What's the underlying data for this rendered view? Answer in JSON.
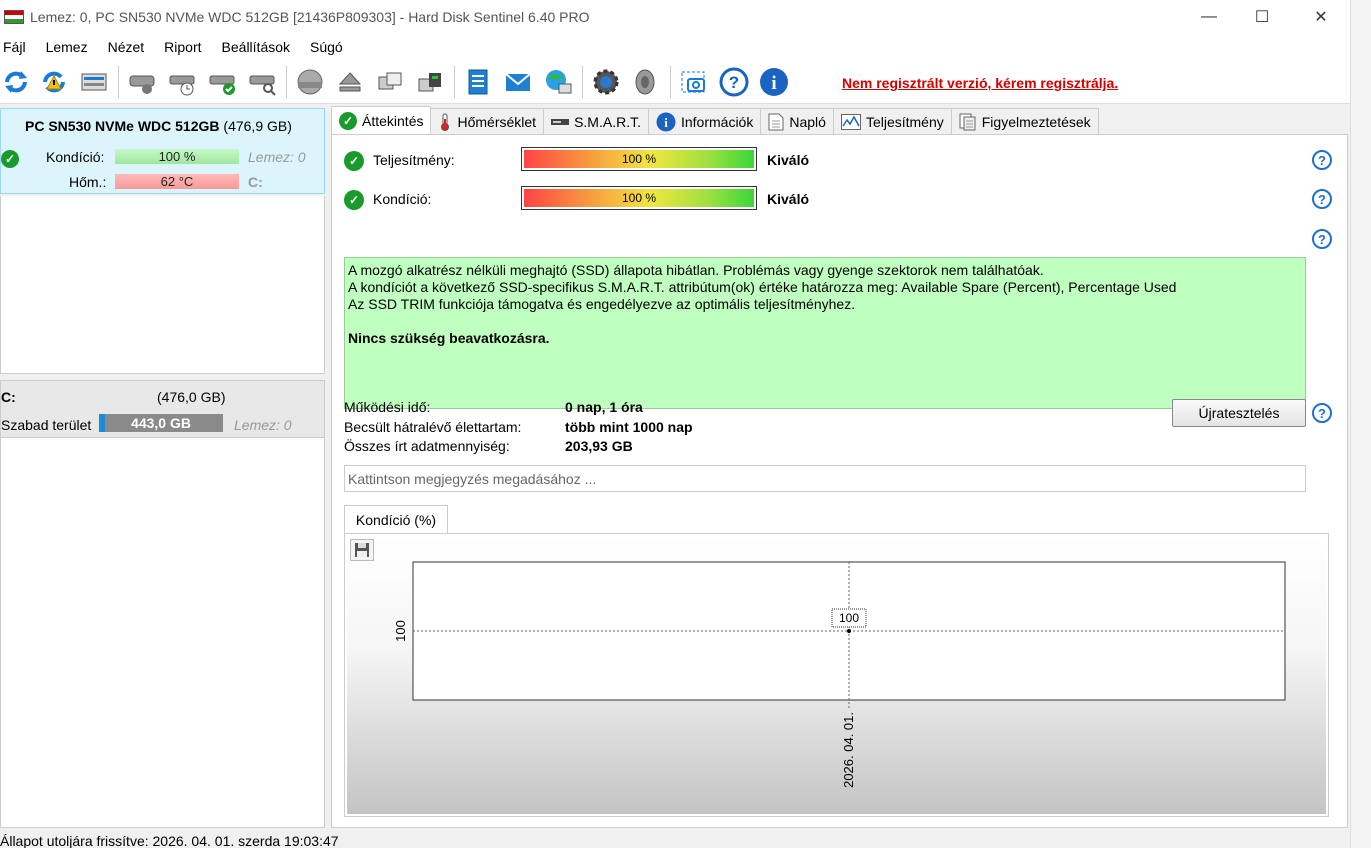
{
  "window": {
    "title": "Lemez: 0, PC SN530 NVMe WDC 512GB [21436P809303]  -  Hard Disk Sentinel 6.40 PRO",
    "min": "—",
    "max": "☐",
    "close": "✕"
  },
  "menu": {
    "items": [
      {
        "label": "Fájl"
      },
      {
        "label": "Lemez"
      },
      {
        "label": "Nézet"
      },
      {
        "label": "Riport"
      },
      {
        "label": "Beállítások"
      },
      {
        "label": "Súgó"
      }
    ]
  },
  "toolbar": {
    "registration_text": "Nem regisztrált verzió, kérem regisztrálja."
  },
  "disk": {
    "name": "PC SN530 NVMe WDC 512GB",
    "size": "(476,9 GB)",
    "health_label": "Kondíció:",
    "health_value": "100 %",
    "health_disk": "Lemez: 0",
    "temp_label": "Hőm.:",
    "temp_value": "62 °C",
    "temp_drive": "C:",
    "health_percent": 100
  },
  "volume": {
    "letter": "C:",
    "size": "(476,0 GB)",
    "free_label": "Szabad terület",
    "free_value": "443,0 GB",
    "disk": "Lemez: 0"
  },
  "tabs": [
    {
      "label": "Áttekintés",
      "icon": "check-icon"
    },
    {
      "label": "Hőmérséklet",
      "icon": "thermometer-icon"
    },
    {
      "label": "S.M.A.R.T.",
      "icon": "drive-icon"
    },
    {
      "label": "Információk",
      "icon": "info-icon"
    },
    {
      "label": "Napló",
      "icon": "document-icon"
    },
    {
      "label": "Teljesítmény",
      "icon": "chart-icon"
    },
    {
      "label": "Figyelmeztetések",
      "icon": "warning-doc-icon"
    }
  ],
  "overview": {
    "performance_label": "Teljesítmény:",
    "performance_value": "100 %",
    "performance_rating": "Kiváló",
    "health_label": "Kondíció:",
    "health_value": "100 %",
    "health_rating": "Kiváló",
    "message_lines": [
      "A mozgó alkatrész nélküli meghajtó (SSD) állapota hibátlan. Problémás vagy gyenge szektorok nem találhatóak.",
      "A kondíciót a következő SSD-specifikus S.M.A.R.T. attribútum(ok) értéke határozza meg:  Available Spare (Percent), Percentage Used",
      "Az SSD TRIM funkciója támogatva és engedélyezve az optimális teljesítményhez."
    ],
    "message_bold": "Nincs szükség beavatkozásra.",
    "power_on_label": "Működési idő:",
    "power_on_value": "0 nap, 1 óra",
    "lifetime_label": "Becsült hátralévő élettartam:",
    "lifetime_value": "több mint 1000 nap",
    "written_label": "Összes írt adatmennyiség:",
    "written_value": "203,93 GB",
    "retest_button": "Újratesztelés",
    "note_placeholder": "Kattintson megjegyzés megadásához ..."
  },
  "chart_tab_label": "Kondíció  (%)",
  "chart_data": {
    "type": "line",
    "x": [
      "2026. 04. 01."
    ],
    "series": [
      {
        "values": [
          100
        ]
      }
    ],
    "y_tick_labels": [
      "100"
    ],
    "data_labels": [
      "100"
    ]
  },
  "status": {
    "text": "Állapot utoljára frissítve: 2026. 04. 01. szerda 19:03:47"
  }
}
